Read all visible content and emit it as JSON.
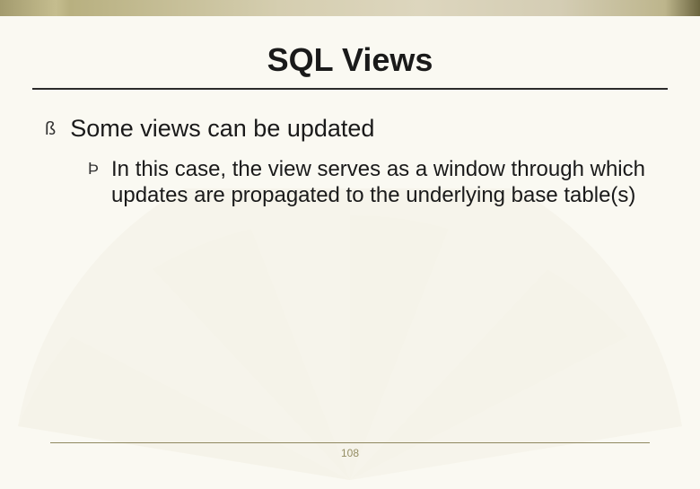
{
  "slide": {
    "title": "SQL Views",
    "bullet_l1": "Some views can be updated",
    "bullet_l2": "In this case, the view serves as a window through which updates are propagated to the underlying base table(s)",
    "page_number": "108"
  }
}
